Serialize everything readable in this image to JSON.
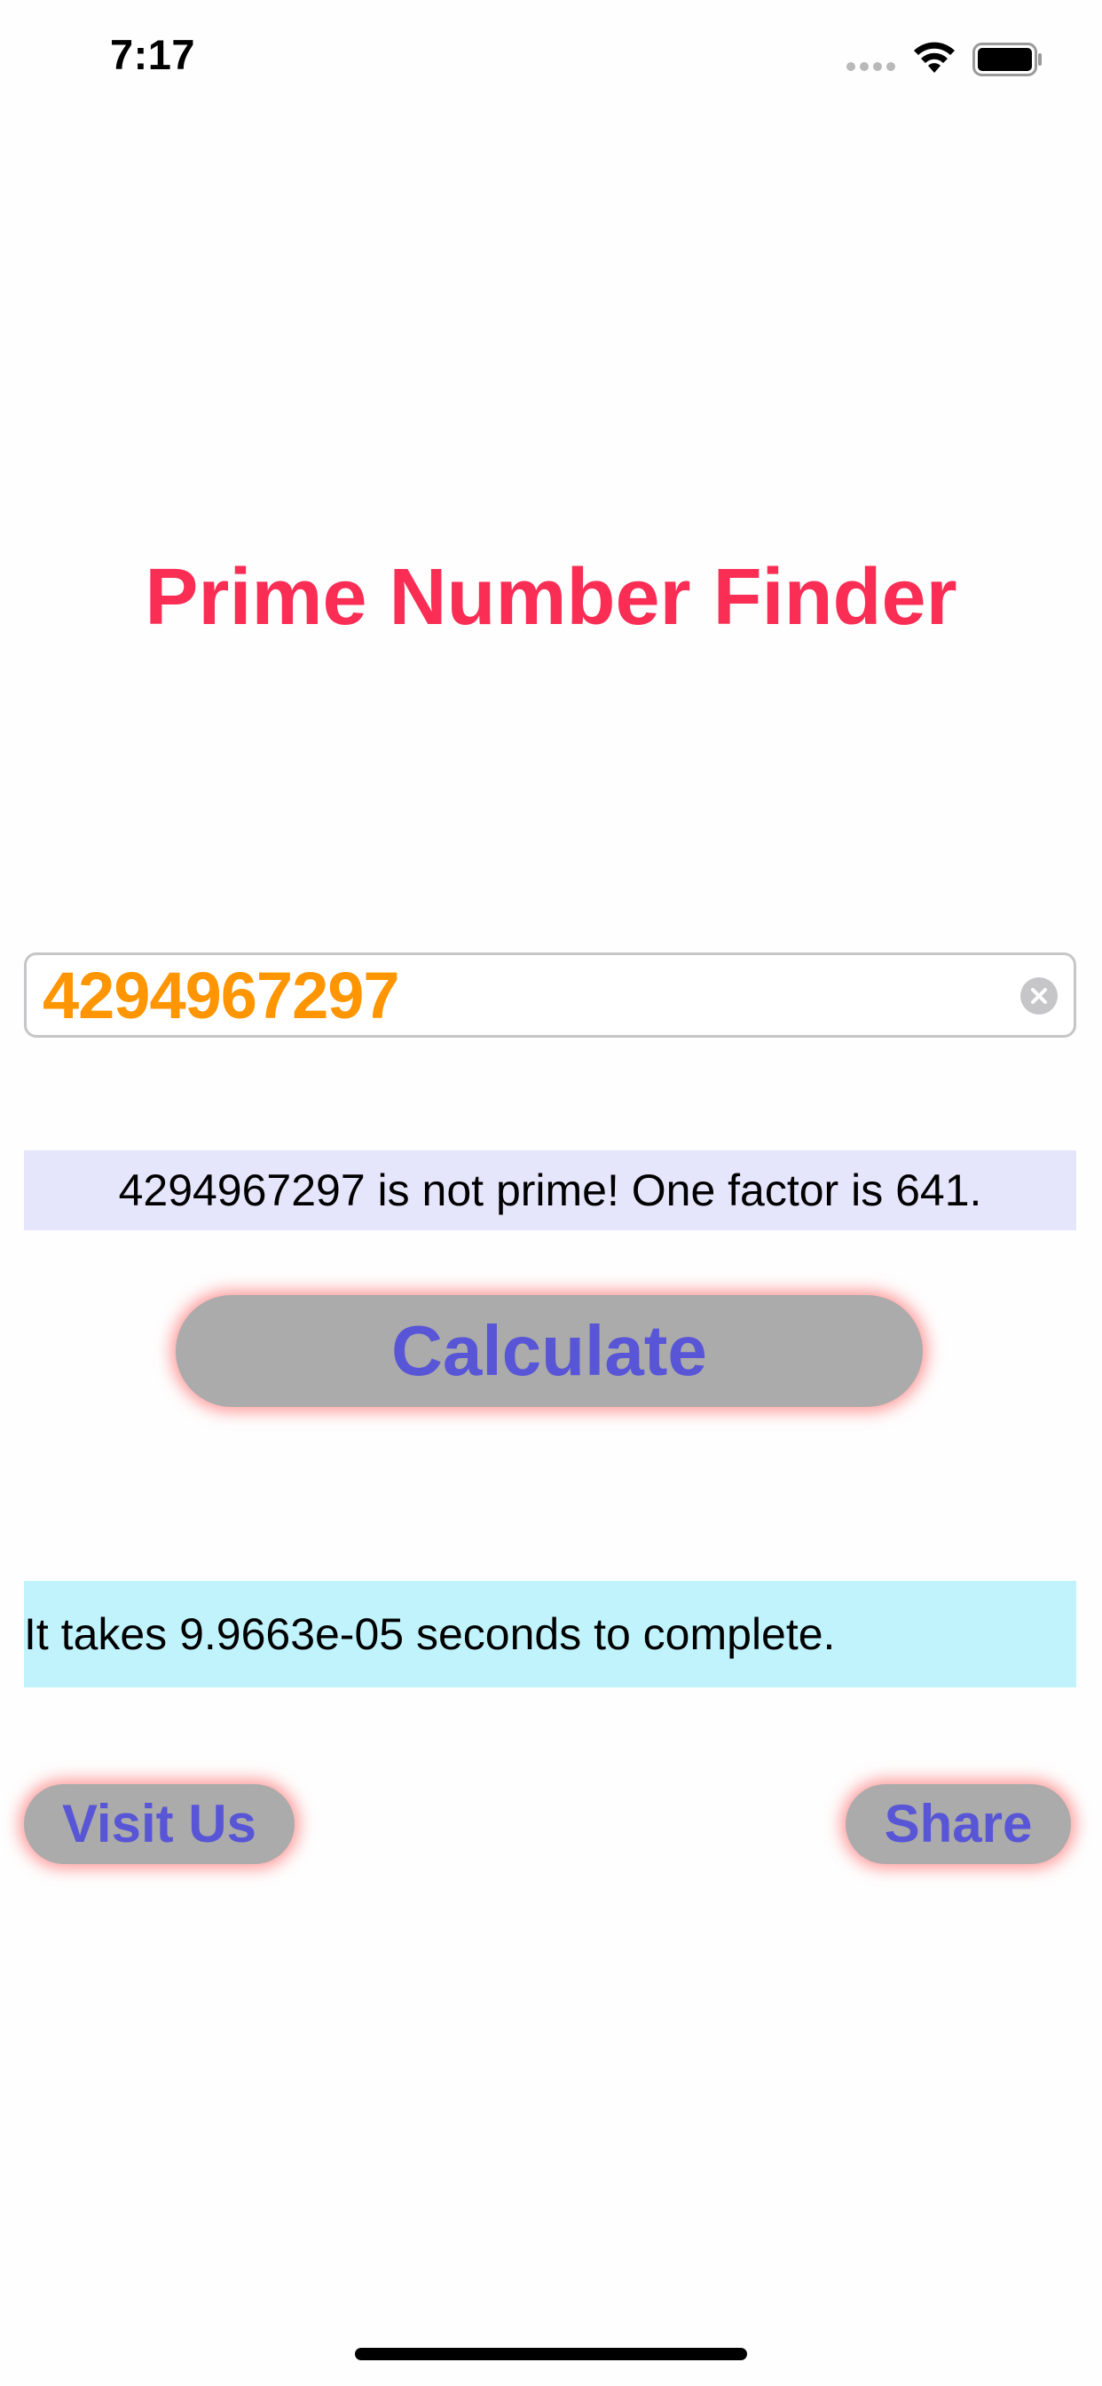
{
  "status_bar": {
    "time": "7:17"
  },
  "app": {
    "title": "Prime Number Finder",
    "number_input": {
      "value": "4294967297",
      "placeholder": ""
    },
    "result_text": "4294967297 is not prime! One factor is 641.",
    "calculate_label": "Calculate",
    "timing_text": "It takes 9.9663e-05 seconds to complete.",
    "visit_label": "Visit Us",
    "share_label": "Share"
  },
  "colors": {
    "title": "#fa2d55",
    "input_text": "#ff9500",
    "button_text": "#5856d6",
    "button_bg": "#ababab",
    "button_glow": "#ff4646",
    "result_bg": "#e5e5fb",
    "timing_bg": "#c1f3fd"
  },
  "icons": {
    "clear": "clear-x-circle-icon",
    "signal": "signal-dots-icon",
    "wifi": "wifi-icon",
    "battery": "battery-icon"
  }
}
